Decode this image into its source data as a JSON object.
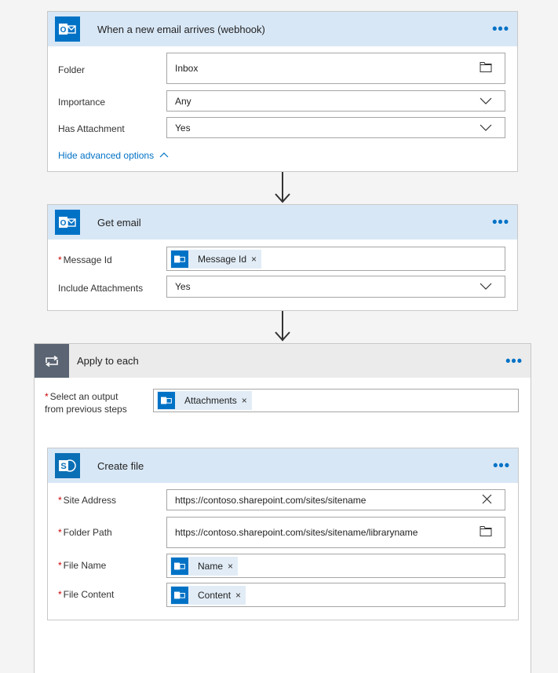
{
  "trigger": {
    "title": "When a new email arrives (webhook)",
    "icon": "outlook-icon",
    "fields": {
      "folder_label": "Folder",
      "folder_value": "Inbox",
      "importance_label": "Importance",
      "importance_value": "Any",
      "attachment_label": "Has Attachment",
      "attachment_value": "Yes"
    },
    "advanced_link": "Hide advanced options"
  },
  "get_email": {
    "title": "Get email",
    "icon": "outlook-icon",
    "fields": {
      "message_id_label": "Message Id",
      "message_id_token": "Message Id",
      "include_label": "Include Attachments",
      "include_value": "Yes"
    }
  },
  "apply_each": {
    "title": "Apply to each",
    "icon": "loop-icon",
    "select_label_1": "Select an output",
    "select_label_2": "from previous steps",
    "select_token": "Attachments"
  },
  "create_file": {
    "title": "Create file",
    "icon": "sharepoint-icon",
    "fields": {
      "site_label": "Site Address",
      "site_value": "https://contoso.sharepoint.com/sites/sitename",
      "folder_label": "Folder Path",
      "folder_value": "https://contoso.sharepoint.com/sites/sitename/libraryname",
      "name_label": "File Name",
      "name_token": "Name",
      "content_label": "File Content",
      "content_token": "Content"
    }
  },
  "ui": {
    "more": "•••",
    "remove": "×",
    "required": "*",
    "colors": {
      "accent": "#0072c6",
      "header_bg": "#d8e7f6",
      "required": "#cc0000"
    }
  }
}
